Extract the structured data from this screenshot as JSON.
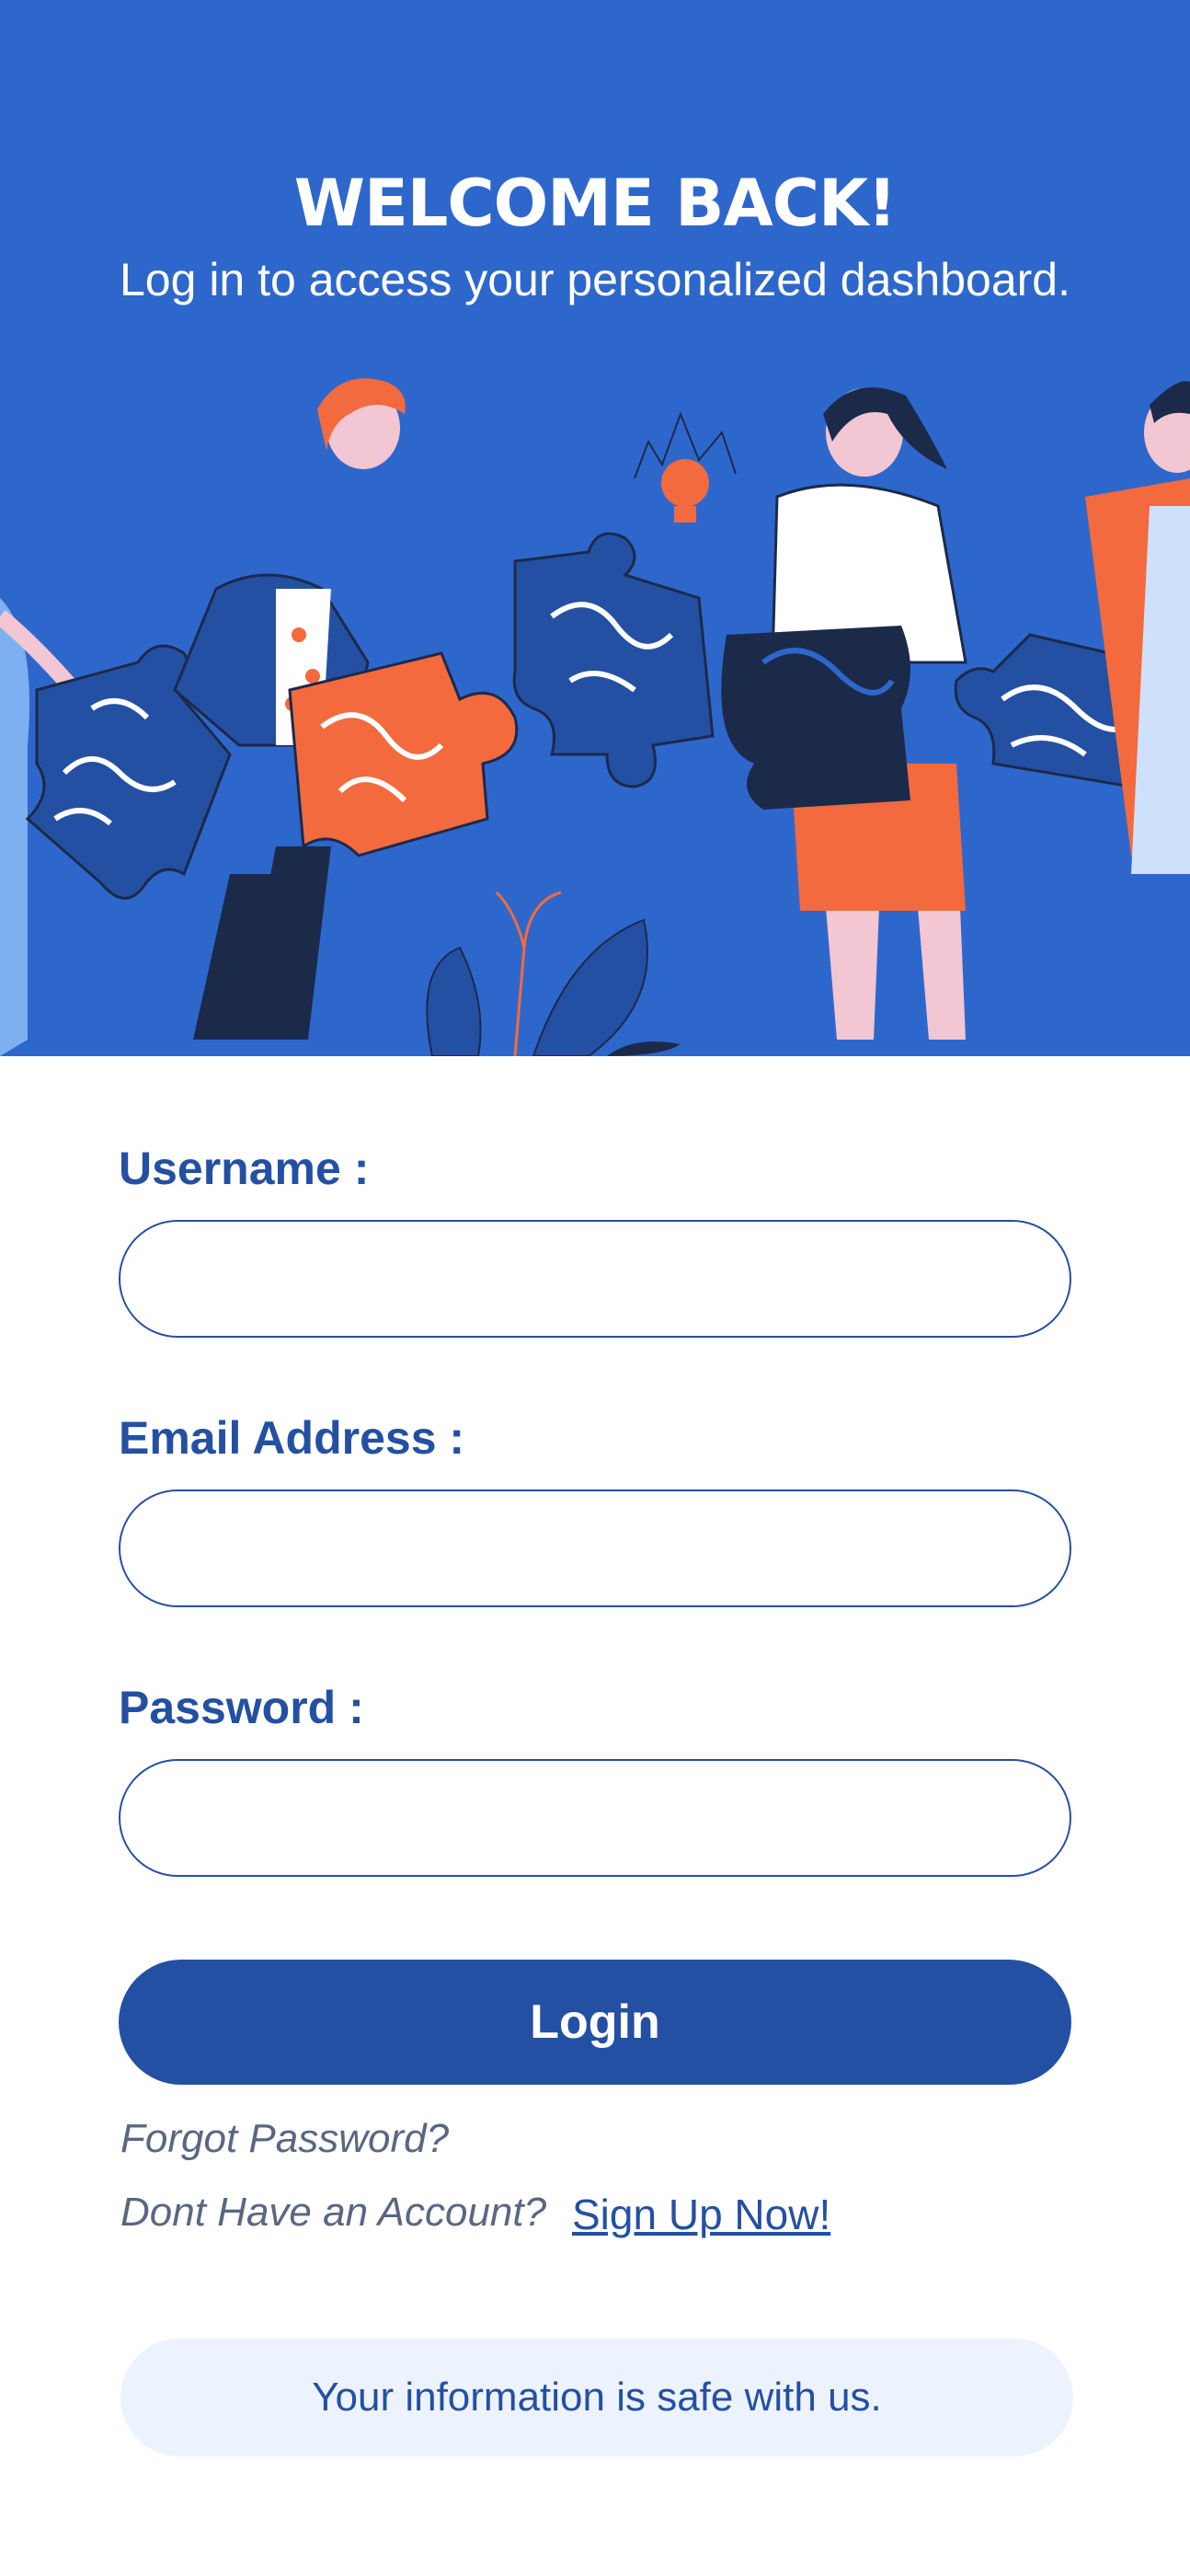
{
  "header": {
    "title": "WELCOME BACK!",
    "subtitle": "Log in to access your personalized dashboard."
  },
  "illustration": {
    "icon": "people-with-puzzle-pieces-illustration"
  },
  "form": {
    "username_label": "Username :",
    "username_value": "",
    "email_label": "Email Address :",
    "email_value": "",
    "password_label": "Password :",
    "password_value": ""
  },
  "actions": {
    "login_label": "Login",
    "forgot_password": "Forgot Password?",
    "no_account": "Dont Have an Account?",
    "signup_link": "Sign Up Now!"
  },
  "footer": {
    "safe_message": "Your information is safe with us."
  },
  "colors": {
    "hero_background": "#2e67cc",
    "primary": "#2450a3",
    "accent_orange": "#f26a3d",
    "navy": "#1c2a4a",
    "badge_background": "#edf3fe"
  }
}
